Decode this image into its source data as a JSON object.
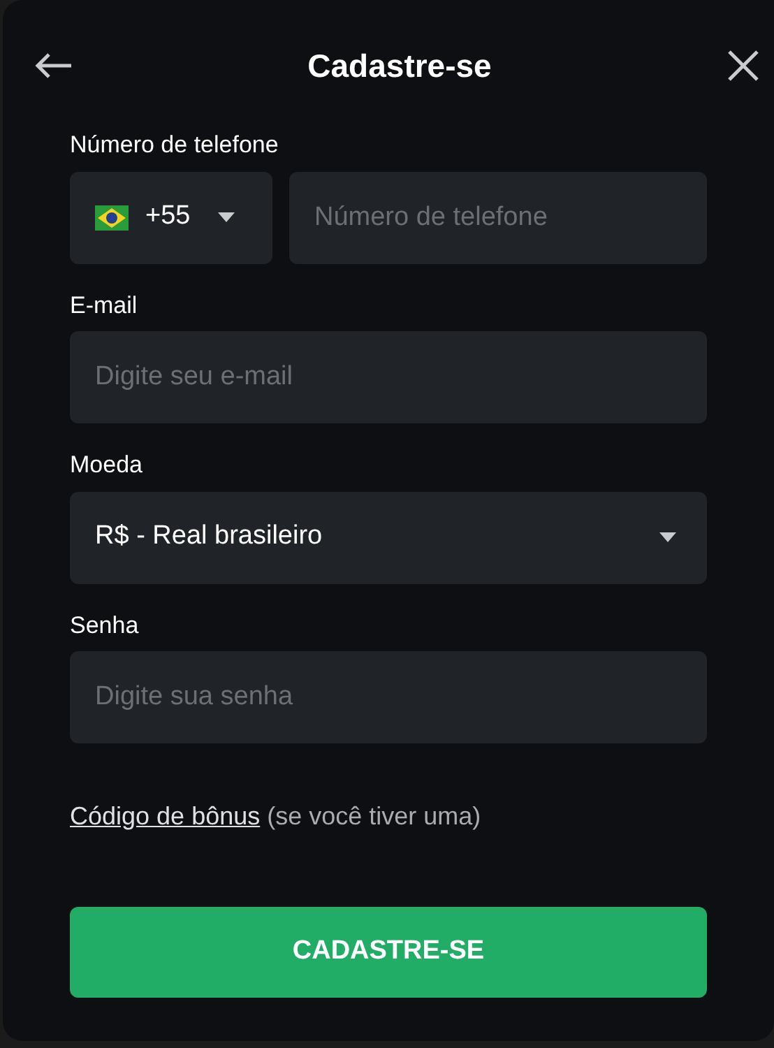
{
  "header": {
    "title": "Cadastre-se"
  },
  "fields": [
    {
      "kind": "phone",
      "label": "Número de telefone",
      "country_code": "+55",
      "placeholder": "Número de telefone"
    },
    {
      "kind": "text",
      "label": "E-mail",
      "placeholder": "Digite seu e-mail"
    },
    {
      "kind": "select",
      "label": "Moeda",
      "value": "R$ - Real brasileiro"
    },
    {
      "kind": "password",
      "label": "Senha",
      "placeholder": "Digite sua senha"
    }
  ],
  "bonus": {
    "link": "Código de bônus",
    "note": "(se você tiver uma)"
  },
  "submit_button": "CADASTRE-SE"
}
